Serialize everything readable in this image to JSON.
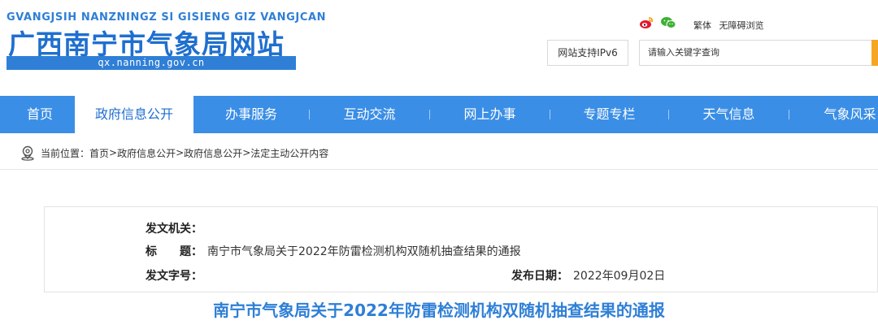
{
  "header": {
    "logo_sub": "GVANGJSIH NANZNINGZ SI GISIENG GIZ VANGJCAN",
    "logo_title": "广西南宁市气象局网站",
    "logo_url": "qx.nanning.gov.cn",
    "social": [
      "weibo-icon",
      "wechat-icon"
    ],
    "links": {
      "traditional": "繁体",
      "accessibility": "无障碍浏览"
    },
    "ipv6_label": "网站支持IPv6",
    "search_placeholder": "请输入关键字查询"
  },
  "nav": {
    "items": [
      {
        "label": "首页"
      },
      {
        "label": "政府信息公开"
      },
      {
        "label": "办事服务"
      },
      {
        "label": "互动交流"
      },
      {
        "label": "网上办事"
      },
      {
        "label": "专题专栏"
      },
      {
        "label": "天气信息"
      },
      {
        "label": "气象风采"
      }
    ],
    "active": "政府信息公开"
  },
  "breadcrumb": {
    "prefix": "当前位置：",
    "items": [
      "首页",
      "政府信息公开",
      "政府信息公开",
      "法定主动公开内容"
    ],
    "separator": " > "
  },
  "info": {
    "issuer_label": "发文机关：",
    "issuer_value": "",
    "title_label": "标　　题：",
    "title_value": "南宁市气象局关于2022年防雷检测机构双随机抽查结果的通报",
    "docno_label": "发文字号：",
    "docno_value": "",
    "date_label": "发布日期：",
    "date_value": "2022年09月02日"
  },
  "article": {
    "title": "南宁市气象局关于2022年防雷检测机构双随机抽查结果的通报"
  },
  "colors": {
    "brand_blue": "#1f6fcf",
    "nav_blue": "#3a8ee6",
    "search_orange": "#f5a623"
  }
}
